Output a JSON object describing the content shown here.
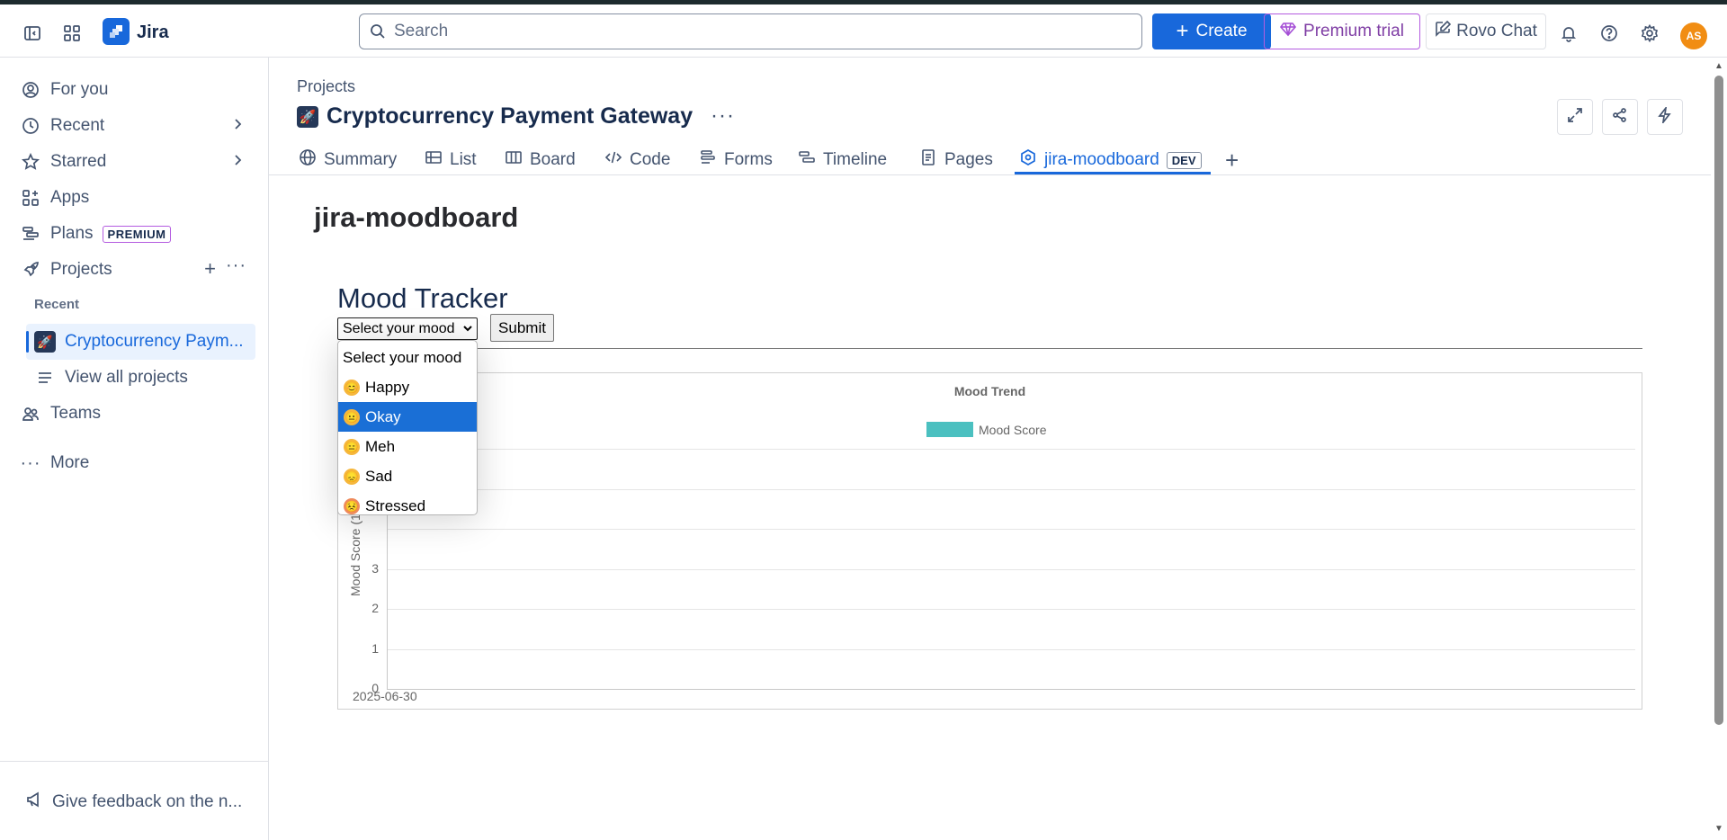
{
  "app": {
    "name": "Jira"
  },
  "topnav": {
    "search_placeholder": "Search",
    "create_label": "Create",
    "premium_label": "Premium trial",
    "rovo_label": "Rovo Chat",
    "avatar_initials": "AS"
  },
  "sidebar": {
    "for_you": "For you",
    "recent": "Recent",
    "starred": "Starred",
    "apps": "Apps",
    "plans": "Plans",
    "plans_badge": "PREMIUM",
    "projects": "Projects",
    "recent_section": "Recent",
    "recent_project": "Cryptocurrency Paym...",
    "view_all": "View all projects",
    "teams": "Teams",
    "more": "More",
    "feedback": "Give feedback on the n..."
  },
  "header": {
    "breadcrumb": "Projects",
    "project_title": "Cryptocurrency Payment Gateway",
    "more": "···"
  },
  "tabs": [
    {
      "label": "Summary"
    },
    {
      "label": "List"
    },
    {
      "label": "Board"
    },
    {
      "label": "Code"
    },
    {
      "label": "Forms"
    },
    {
      "label": "Timeline"
    },
    {
      "label": "Pages"
    },
    {
      "label": "jira-moodboard",
      "badge": "DEV",
      "active": true
    }
  ],
  "app_content": {
    "title": "jira-moodboard",
    "heading": "Mood Tracker",
    "select_value": "Select your mood",
    "submit_label": "Submit",
    "options": [
      {
        "label": "Select your mood",
        "emoji": ""
      },
      {
        "label": "Happy",
        "emoji": "😊"
      },
      {
        "label": "Okay",
        "emoji": "😐",
        "selected": true
      },
      {
        "label": "Meh",
        "emoji": "😑"
      },
      {
        "label": "Sad",
        "emoji": "😞"
      },
      {
        "label": "Stressed",
        "emoji": "😣"
      }
    ]
  },
  "chart_data": {
    "type": "bar",
    "title": "Mood Trend",
    "categories": [
      "2025-06-30"
    ],
    "series": [
      {
        "name": "Mood Score",
        "values": []
      }
    ],
    "ylabel": "Mood Score (1–5)",
    "yticks": [
      0,
      1,
      2,
      3
    ],
    "ylim": [
      0,
      6
    ],
    "legend": "top",
    "grid": true,
    "color": "#4bc0c0"
  },
  "colors": {
    "brand": "#1868db",
    "premium": "#803fa5",
    "avatar": "#f18d13"
  }
}
